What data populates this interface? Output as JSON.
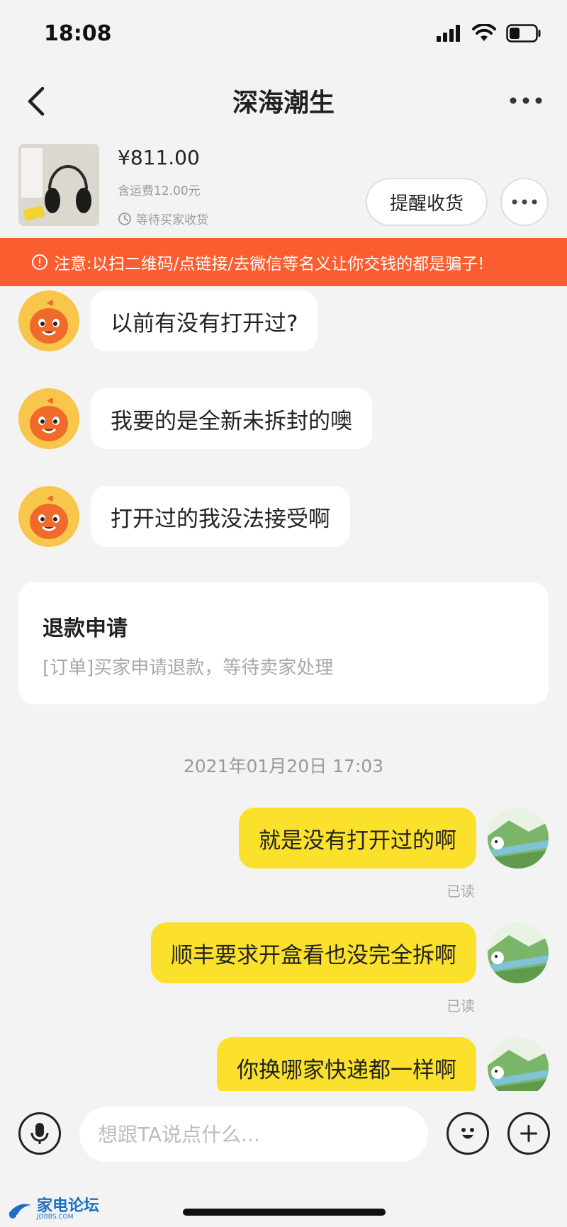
{
  "status_bar": {
    "time": "18:08"
  },
  "header": {
    "title": "深海潮生"
  },
  "product": {
    "price": "¥811.00",
    "shipping": "含运费12.00元",
    "status": "等待买家收货",
    "remind_button": "提醒收货"
  },
  "banner": {
    "text": "注意:以扫二维码/点链接/去微信等名义让你交钱的都是骗子!"
  },
  "messages": {
    "seller": [
      "以前有没有打开过?",
      "我要的是全新未拆封的噢",
      "打开过的我没法接受啊"
    ],
    "refund": {
      "title": "退款申请",
      "desc": "[订单]买家申请退款，等待卖家处理"
    },
    "timestamp": "2021年01月20日 17:03",
    "buyer": [
      {
        "text": "就是没有打开过的啊",
        "status": "已读"
      },
      {
        "text": "顺丰要求开盒看也没完全拆啊",
        "status": "已读"
      },
      {
        "text": "你换哪家快递都一样啊"
      }
    ]
  },
  "input": {
    "placeholder": "想跟TA说点什么..."
  },
  "watermark": {
    "text": "家电论坛",
    "sub": "JDBBS.COM"
  },
  "colors": {
    "banner": "#fa5d2f",
    "buyer_bubble": "#fbe12c",
    "seller_avatar": "#f7c64b",
    "background": "#f3f3f3"
  }
}
